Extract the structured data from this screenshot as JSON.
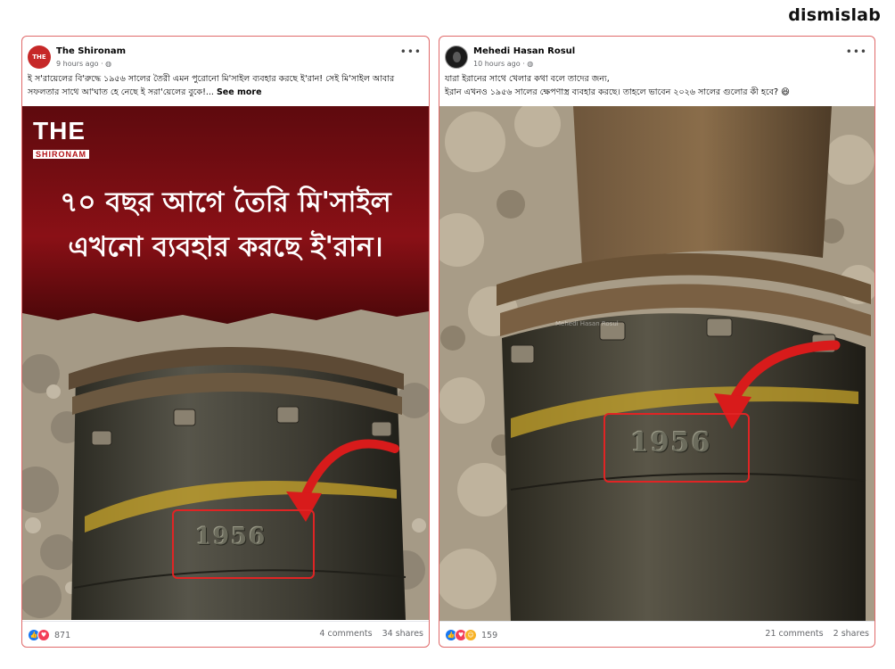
{
  "brand": "dismislab",
  "posts": [
    {
      "author": "The Shironam",
      "avatar_text": "THE",
      "time": "9 hours ago · ",
      "privacy_icon": "globe-icon",
      "text": "ই স'রায়েলের বি'রুদ্ধে ১৯৫৬ সালের তৈরী এমন পুরোনো মি'সাইল ব্যবহার করছে ই'রান! সেই মি'সাইল আবার সফলতার সাথে আ'ঘাত হে নেছে ই সরা'য়েলের বুকে!...",
      "see_more": "See more",
      "logo_the": "THE",
      "logo_sub": "SHIRONAM",
      "headline_1": "৭০ বছর আগে তৈরি মি'সাইল",
      "headline_2": "এখনো ব্যবহার করছে ই'রান।",
      "stamp": "1956",
      "reaction_count": "871",
      "comments": "4 comments",
      "shares": "34 shares"
    },
    {
      "author": "Mehedi Hasan Rosul",
      "time": "10 hours ago · ",
      "privacy_icon": "globe-icon",
      "text_1": "যারা ইরানের সাথে খেলার কথা বলে তাদের জন্য,",
      "text_2": "ইরান এখনও ১৯৫৬ সালের ক্ষেপণাস্ত্র ব্যবহার করছে। তাহলে ভাবেন ২০২৬ সালের গুলোর কী হবে? 😆",
      "watermark": "Mehedi Hasan Rosul",
      "stamp": "1956",
      "reaction_count": "159",
      "comments": "21 comments",
      "shares": "2 shares"
    }
  ],
  "colors": {
    "highlight": "#e02424",
    "poster_red": "#7a0d12",
    "link_blue": "#1877f2"
  }
}
